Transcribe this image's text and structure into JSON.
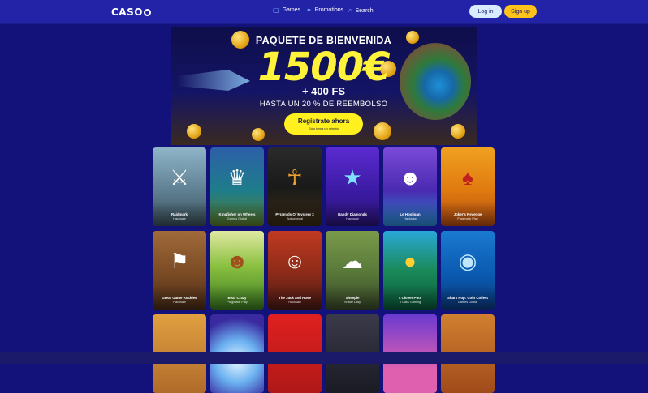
{
  "header": {
    "logo_text": "CASO",
    "nav": [
      {
        "label": "Games",
        "icon": "games-icon"
      },
      {
        "label": "Promotions",
        "icon": "promotions-icon"
      },
      {
        "label": "Search",
        "icon": "search-icon"
      }
    ],
    "login_label": "Log in",
    "signup_label": "Sign up"
  },
  "hero": {
    "title": "PAQUETE DE BIENVENIDA",
    "amount": "1500€",
    "free_spins": "+ 400 FS",
    "refund": "HASTA UN 20 % DE REEMBOLSO",
    "cta_label": "Regístrate ahora",
    "cta_sublabel": "Sólo toma un minuto"
  },
  "games": [
    {
      "name": "Raidmark",
      "provider": "Hacksaw"
    },
    {
      "name": "Kingfisher on Wheels",
      "provider": "Games Global"
    },
    {
      "name": "Pyramids Of Mystery 2",
      "provider": "Spinomenal"
    },
    {
      "name": "Dandy Diamonds",
      "provider": "Hacksaw"
    },
    {
      "name": "Le Hooligan",
      "provider": "Hacksaw"
    },
    {
      "name": "Joker's Revenge",
      "provider": "Pragmatic Play"
    },
    {
      "name": "Great Game Rockies",
      "provider": "Hacksaw"
    },
    {
      "name": "Bear Crazy",
      "provider": "Pragmatic Play"
    },
    {
      "name": "The Jack and Rose",
      "provider": "Hacksaw"
    },
    {
      "name": "Sheepie",
      "provider": "Shady Lady"
    },
    {
      "name": "4 Clover Pots",
      "provider": "3 Oaks Gaming"
    },
    {
      "name": "Shark Pop: Coin Collect",
      "provider": "Games Global"
    },
    {
      "name": "",
      "provider": ""
    },
    {
      "name": "",
      "provider": ""
    },
    {
      "name": "",
      "provider": ""
    },
    {
      "name": "",
      "provider": ""
    },
    {
      "name": "",
      "provider": ""
    },
    {
      "name": "",
      "provider": ""
    }
  ],
  "colors": {
    "page_bg": "#13127a",
    "header_bg": "#2323a8",
    "accent_yellow": "#ffc31a",
    "login_bg": "#d7ecff"
  }
}
